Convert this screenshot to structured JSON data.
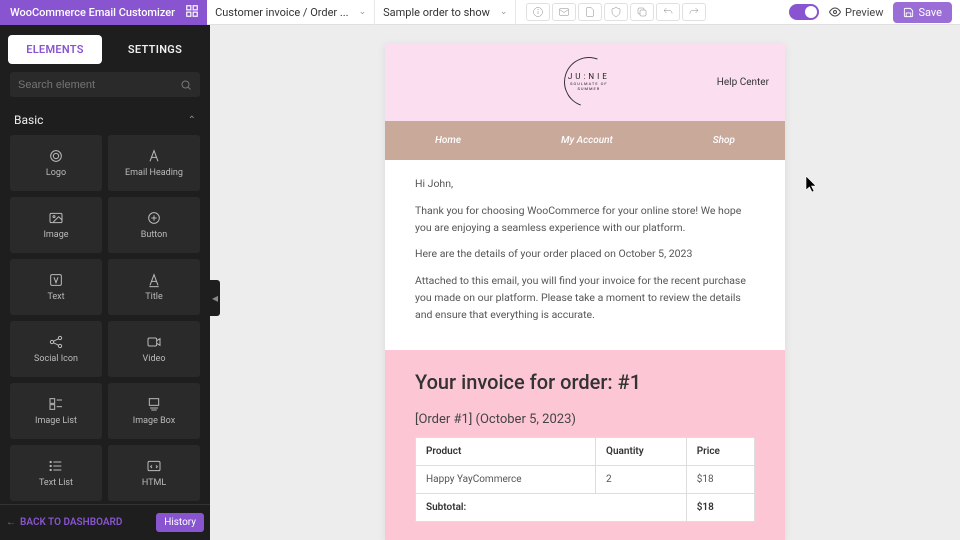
{
  "app_title": "WooCommerce Email Customizer",
  "template_select": "Customer invoice / Order ...",
  "sample_select": "Sample order to show",
  "preview_label": "Preview",
  "save_label": "Save",
  "tabs": {
    "elements": "ELEMENTS",
    "settings": "SETTINGS"
  },
  "search_placeholder": "Search element",
  "section_basic": "Basic",
  "elements": {
    "logo": "Logo",
    "heading": "Email Heading",
    "image": "Image",
    "button": "Button",
    "text": "Text",
    "title": "Title",
    "social": "Social Icon",
    "video": "Video",
    "imglist": "Image List",
    "imgbox": "Image Box",
    "textlist": "Text List",
    "html": "HTML"
  },
  "back_label": "BACK TO DASHBOARD",
  "history_label": "History",
  "email": {
    "logo_main": "JU:NIE",
    "logo_sub": "SOULMATE OF SUMMER",
    "help": "Help Center",
    "nav": {
      "home": "Home",
      "account": "My Account",
      "shop": "Shop"
    },
    "greeting": "Hi John,",
    "p1": "Thank you for choosing WooCommerce for your online store! We hope you are enjoying a seamless experience with our platform.",
    "p2": "Here are the details of your order placed on October 5, 2023",
    "p3": "Attached to this email, you will find your invoice for the recent purchase you made on our platform. Please take a moment to review the details and ensure that everything is accurate.",
    "invoice_title": "Your invoice for order: #1",
    "invoice_sub": "[Order #1] (October 5, 2023)",
    "cols": {
      "product": "Product",
      "qty": "Quantity",
      "price": "Price"
    },
    "row": {
      "name": "Happy YayCommerce",
      "qty": "2",
      "price": "$18"
    },
    "subtotal_label": "Subtotal:",
    "subtotal_val": "$18"
  }
}
